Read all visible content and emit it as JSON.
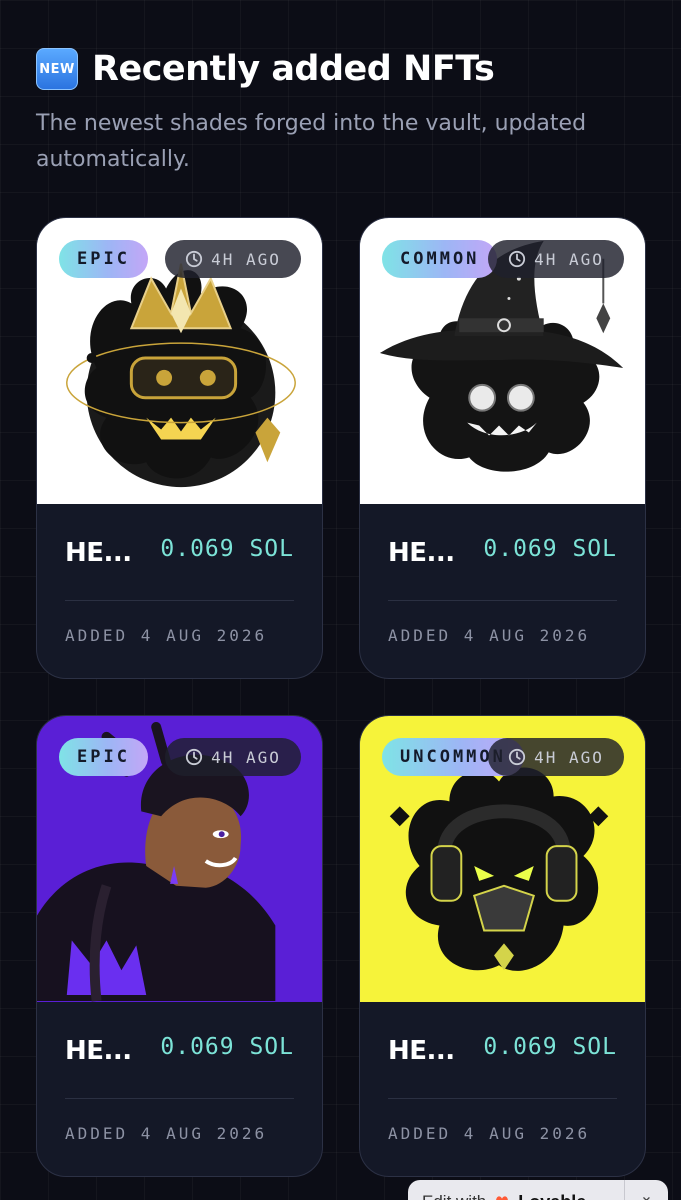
{
  "header": {
    "badge": "NEW",
    "title": "Recently added NFTs",
    "subtitle": "The newest shades forged into the vault, updated automatically."
  },
  "cards": [
    {
      "rarity": "EPIC",
      "time": "4H AGO",
      "name": "HE...",
      "price": "0.069 SOL",
      "date": "ADDED 4 AUG 2026",
      "image_bg": "#ffffff",
      "art": "crowned-shade"
    },
    {
      "rarity": "COMMON",
      "time": "4H AGO",
      "name": "HE...",
      "price": "0.069 SOL",
      "date": "ADDED 4 AUG 2026",
      "image_bg": "#ffffff",
      "art": "wizard-shade"
    },
    {
      "rarity": "EPIC",
      "time": "4H AGO",
      "name": "HE...",
      "price": "0.069 SOL",
      "date": "ADDED 4 AUG 2026",
      "image_bg": "#5a1fd6",
      "art": "hooded-character"
    },
    {
      "rarity": "UNCOMMON",
      "time": "4H AGO",
      "name": "HE...",
      "price": "0.069 SOL",
      "date": "ADDED 4 AUG 2026",
      "image_bg": "#f6f33a",
      "art": "headphone-shade"
    }
  ],
  "edit_bar": {
    "prefix": "Edit with",
    "brand": "Lovable",
    "close_icon": "chevron-down-icon"
  },
  "colors": {
    "accent_price": "#7ce3d7",
    "background": "#0c0d16",
    "card": "#141827"
  }
}
